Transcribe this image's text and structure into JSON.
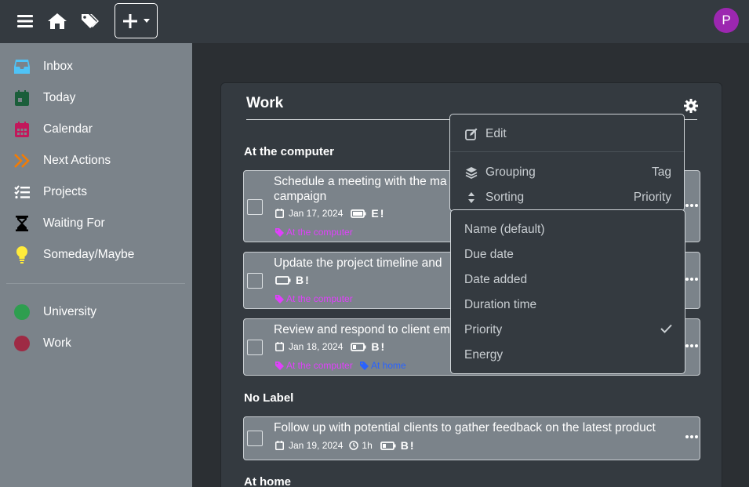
{
  "topbar": {
    "avatar_initial": "P"
  },
  "sidebar": {
    "items": [
      {
        "label": "Inbox",
        "icon": "inbox-icon",
        "color": "#4fc3f7"
      },
      {
        "label": "Today",
        "icon": "calendar-day-icon",
        "color": "#1b5e3a"
      },
      {
        "label": "Calendar",
        "icon": "calendar-icon",
        "color": "#c2185b"
      },
      {
        "label": "Next Actions",
        "icon": "double-chevron-right-icon",
        "color": "#f57c00"
      },
      {
        "label": "Projects",
        "icon": "list-check-icon",
        "color": "#ffffff"
      },
      {
        "label": "Waiting For",
        "icon": "hourglass-icon",
        "color": "#000000"
      },
      {
        "label": "Someday/Maybe",
        "icon": "lightbulb-icon",
        "color": "#ffeb3b"
      }
    ],
    "projects": [
      {
        "label": "University",
        "color": "#2e9e4f"
      },
      {
        "label": "Work",
        "color": "#9e2a44"
      }
    ]
  },
  "project": {
    "title": "Work",
    "groups": [
      {
        "title": "At the computer",
        "tasks": [
          {
            "title": "Schedule a meeting with the ma",
            "title2": "campaign",
            "date": "Jan 17, 2024",
            "badge": "E!",
            "tags": [
              "At the computer"
            ]
          },
          {
            "title": "Update the project timeline and",
            "badge": "B!",
            "tags": [
              "At the computer"
            ]
          },
          {
            "title": "Review and respond to client em",
            "date": "Jan 18, 2024",
            "badge": "B!",
            "tags": [
              "At the computer",
              "At home"
            ]
          }
        ]
      },
      {
        "title": "No Label",
        "tasks": [
          {
            "title": "Follow up with potential clients to gather feedback on the latest product",
            "date": "Jan 19, 2024",
            "duration": "1h",
            "badge": "B!"
          }
        ]
      },
      {
        "title": "At home"
      }
    ]
  },
  "settings_menu": {
    "edit": "Edit",
    "grouping_label": "Grouping",
    "grouping_value": "Tag",
    "sorting_label": "Sorting",
    "sorting_value": "Priority"
  },
  "sort_options": [
    "Name (default)",
    "Due date",
    "Date added",
    "Duration time",
    "Priority",
    "Energy"
  ],
  "sort_selected": "Priority",
  "colors": {
    "tag_computer": "#e040fb",
    "tag_home": "#2962ff"
  }
}
